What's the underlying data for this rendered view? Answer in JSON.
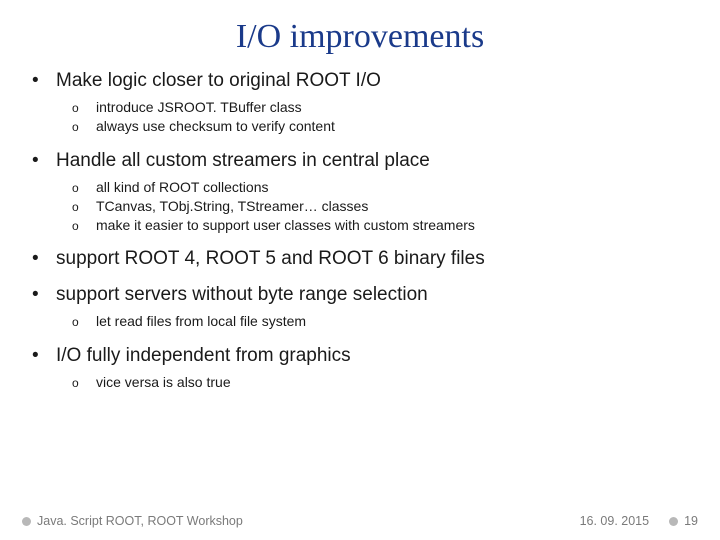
{
  "title": "I/O improvements",
  "bullets": [
    {
      "text": "Make logic closer to original ROOT I/O",
      "sub": [
        "introduce JSROOT. TBuffer class",
        "always use checksum to verify content"
      ]
    },
    {
      "text": "Handle all custom streamers in central place",
      "sub": [
        "all kind of ROOT collections",
        "TCanvas, TObj.String, TStreamer… classes",
        "make it easier to support user classes with custom streamers"
      ]
    },
    {
      "text": "support ROOT 4, ROOT 5 and ROOT 6 binary files",
      "sub": []
    },
    {
      "text": "support servers without byte range selection",
      "sub": [
        "let read files from local file system"
      ]
    },
    {
      "text": "I/O fully independent from graphics",
      "sub": [
        "vice versa is also true"
      ]
    }
  ],
  "footer": {
    "left": "Java. Script ROOT, ROOT Workshop",
    "date": "16. 09. 2015",
    "page": "19"
  }
}
